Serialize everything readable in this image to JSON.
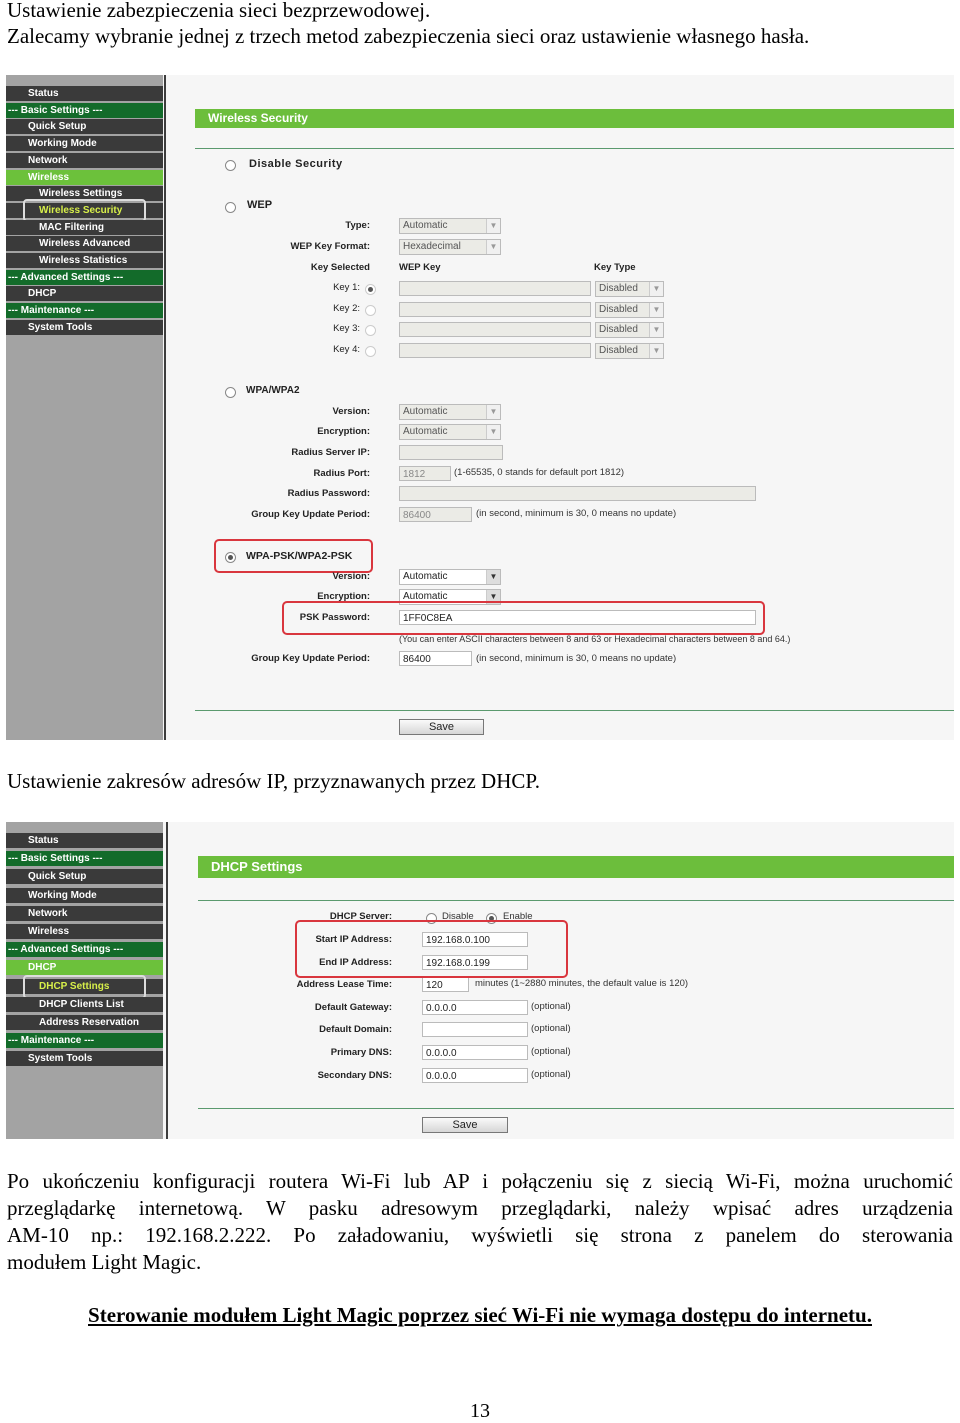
{
  "intro": {
    "line1": "Ustawienie zabezpieczenia sieci bezprzewodowej.",
    "line2": "Zalecamy wybranie jednej z trzech metod zabezpieczenia sieci oraz ustawienie własnego hasła."
  },
  "wireless_shot": {
    "sidebar": [
      {
        "label": "Status",
        "kind": "item",
        "indent": 1
      },
      {
        "label": "--- Basic Settings ---",
        "kind": "group",
        "indent": 0
      },
      {
        "label": "Quick Setup",
        "kind": "item",
        "indent": 1
      },
      {
        "label": "Working Mode",
        "kind": "item",
        "indent": 1
      },
      {
        "label": "Network",
        "kind": "item",
        "indent": 1
      },
      {
        "label": "Wireless",
        "kind": "active",
        "indent": 1
      },
      {
        "label": "Wireless Settings",
        "kind": "item",
        "indent": 2
      },
      {
        "label": "Wireless Security",
        "kind": "selected",
        "indent": 2
      },
      {
        "label": "MAC Filtering",
        "kind": "item",
        "indent": 2
      },
      {
        "label": "Wireless Advanced",
        "kind": "item",
        "indent": 2
      },
      {
        "label": "Wireless Statistics",
        "kind": "item",
        "indent": 2
      },
      {
        "label": "--- Advanced Settings ---",
        "kind": "group",
        "indent": 0
      },
      {
        "label": "DHCP",
        "kind": "item",
        "indent": 1
      },
      {
        "label": "--- Maintenance ---",
        "kind": "group",
        "indent": 0
      },
      {
        "label": "System Tools",
        "kind": "item",
        "indent": 1
      }
    ],
    "title": "Wireless Security",
    "disable_label": "Disable Security",
    "wep": {
      "label": "WEP",
      "type_label": "Type:",
      "type_value": "Automatic",
      "format_label": "WEP Key Format:",
      "format_value": "Hexadecimal",
      "key_selected": "Key Selected",
      "wep_key": "WEP Key",
      "key_type": "Key Type",
      "keys": [
        {
          "label": "Key 1:",
          "value": "",
          "type": "Disabled",
          "selected": true
        },
        {
          "label": "Key 2:",
          "value": "",
          "type": "Disabled",
          "selected": false
        },
        {
          "label": "Key 3:",
          "value": "",
          "type": "Disabled",
          "selected": false
        },
        {
          "label": "Key 4:",
          "value": "",
          "type": "Disabled",
          "selected": false
        }
      ]
    },
    "wpa": {
      "label": "WPA/WPA2",
      "version_label": "Version:",
      "version_value": "Automatic",
      "encryption_label": "Encryption:",
      "encryption_value": "Automatic",
      "radius_ip_label": "Radius Server IP:",
      "radius_ip_value": "",
      "radius_port_label": "Radius Port:",
      "radius_port_value": "1812",
      "radius_port_note": "(1-65535, 0 stands for default port 1812)",
      "radius_pw_label": "Radius Password:",
      "radius_pw_value": "",
      "group_label": "Group Key Update Period:",
      "group_value": "86400",
      "group_note": "(in second, minimum is 30, 0 means no update)"
    },
    "psk": {
      "label": "WPA-PSK/WPA2-PSK",
      "selected": true,
      "version_label": "Version:",
      "version_value": "Automatic",
      "encryption_label": "Encryption:",
      "encryption_value": "Automatic",
      "password_label": "PSK Password:",
      "password_value": "1FF0C8EA",
      "password_note": "(You can enter ASCII characters between 8 and 63 or Hexadecimal characters between 8 and 64.)",
      "group_label": "Group Key Update Period:",
      "group_value": "86400",
      "group_note": "(in second, minimum is 30, 0 means no update)"
    },
    "save": "Save"
  },
  "dhcp_caption": "Ustawienie zakresów adresów IP, przyznawanych przez DHCP.",
  "dhcp_shot": {
    "sidebar": [
      {
        "label": "Status",
        "kind": "item",
        "indent": 1
      },
      {
        "label": "--- Basic Settings ---",
        "kind": "group",
        "indent": 0
      },
      {
        "label": "Quick Setup",
        "kind": "item",
        "indent": 1
      },
      {
        "label": "Working Mode",
        "kind": "item",
        "indent": 1
      },
      {
        "label": "Network",
        "kind": "item",
        "indent": 1
      },
      {
        "label": "Wireless",
        "kind": "item",
        "indent": 1
      },
      {
        "label": "--- Advanced Settings ---",
        "kind": "group",
        "indent": 0
      },
      {
        "label": "DHCP",
        "kind": "active",
        "indent": 1
      },
      {
        "label": "DHCP Settings",
        "kind": "selected",
        "indent": 2
      },
      {
        "label": "DHCP Clients List",
        "kind": "item",
        "indent": 2
      },
      {
        "label": "Address Reservation",
        "kind": "item",
        "indent": 2
      },
      {
        "label": "--- Maintenance ---",
        "kind": "group",
        "indent": 0
      },
      {
        "label": "System Tools",
        "kind": "item",
        "indent": 1
      }
    ],
    "title": "DHCP Settings",
    "server_label": "DHCP Server:",
    "disable": "Disable",
    "enable": "Enable",
    "enabled": true,
    "fields": [
      {
        "label": "Start IP Address:",
        "value": "192.168.0.100",
        "note": ""
      },
      {
        "label": "End IP Address:",
        "value": "192.168.0.199",
        "note": ""
      },
      {
        "label": "Address Lease Time:",
        "value": "120",
        "note": "minutes (1~2880 minutes, the default value is 120)"
      },
      {
        "label": "Default Gateway:",
        "value": "0.0.0.0",
        "note": "(optional)"
      },
      {
        "label": "Default Domain:",
        "value": "",
        "note": "(optional)"
      },
      {
        "label": "Primary DNS:",
        "value": "0.0.0.0",
        "note": "(optional)"
      },
      {
        "label": "Secondary DNS:",
        "value": "0.0.0.0",
        "note": "(optional)"
      }
    ],
    "save": "Save"
  },
  "paragraph": [
    "Po ukończeniu konfiguracji routera Wi-Fi lub AP i połączeniu się z siecią Wi-Fi, można uruchomić",
    "przeglądarkę internetową. W pasku adresowym przeglądarki, należy wpisać adres urządzenia",
    "AM-10 np.: 192.168.2.222. Po załadowaniu, wyświetli się strona z panelem do sterowania",
    "modułem Light Magic."
  ],
  "note": "Sterowanie modułem Light Magic poprzez sieć Wi-Fi nie wymaga dostępu do internetu.",
  "page_number": "13"
}
